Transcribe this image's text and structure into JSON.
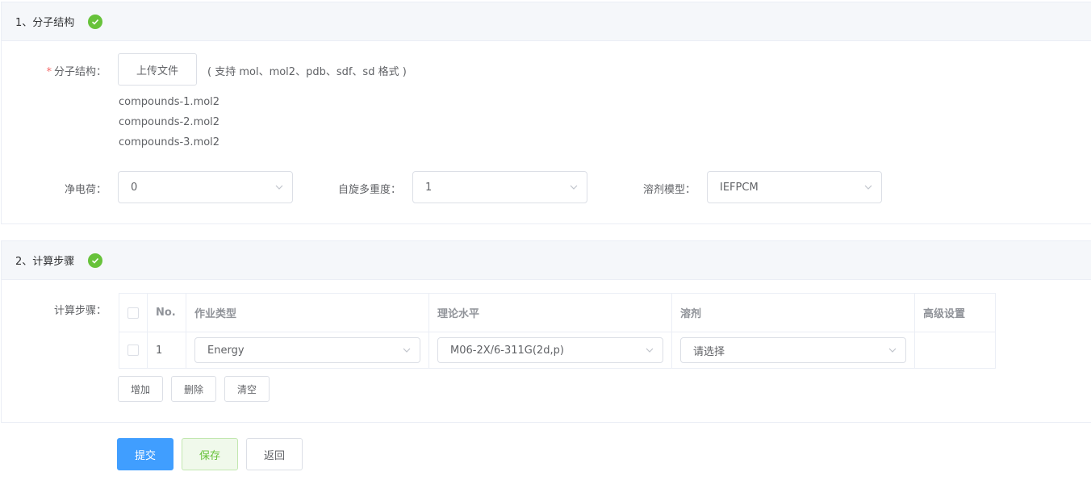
{
  "section1": {
    "title": "1、分子结构",
    "structure_label": "分子结构：",
    "upload_button": "上传文件",
    "upload_hint": "( 支持 mol、mol2、pdb、sdf、sd 格式 )",
    "files": [
      "compounds-1.mol2",
      "compounds-2.mol2",
      "compounds-3.mol2"
    ],
    "charge": {
      "label": "净电荷：",
      "value": "0"
    },
    "multiplicity": {
      "label": "自旋多重度：",
      "value": "1"
    },
    "solvent_model": {
      "label": "溶剂模型：",
      "value": "IEFPCM"
    }
  },
  "section2": {
    "title": "2、计算步骤",
    "steps_label": "计算步骤：",
    "columns": [
      "No.",
      "作业类型",
      "理论水平",
      "溶剂",
      "高级设置"
    ],
    "rows": [
      {
        "no": "1",
        "job_type": "Energy",
        "theory_level": "M06-2X/6-311G(2d,p)",
        "solvent_placeholder": "请选择"
      }
    ],
    "add_button": "增加",
    "delete_button": "删除",
    "clear_button": "清空"
  },
  "footer": {
    "submit_button": "提交",
    "save_button": "保存",
    "back_button": "返回"
  },
  "colors": {
    "primary": "#409eff",
    "success": "#67c23a",
    "danger": "#f56c6c"
  }
}
